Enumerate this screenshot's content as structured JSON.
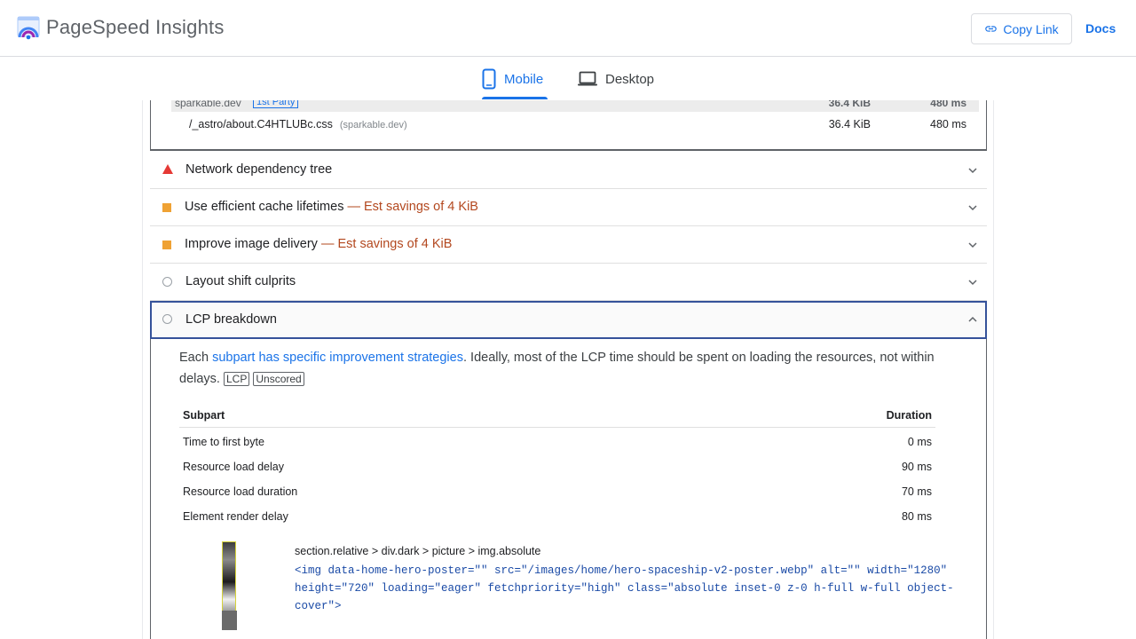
{
  "header": {
    "app_title": "PageSpeed Insights",
    "copy_link_label": "Copy Link",
    "docs_label": "Docs"
  },
  "tabs": [
    {
      "label": "Mobile",
      "selected": true
    },
    {
      "label": "Desktop",
      "selected": false
    }
  ],
  "resource_table": {
    "party_row": {
      "host": "sparkable.dev",
      "badge": "1st Party",
      "size": "36.4 KiB",
      "time": "480 ms"
    },
    "file_row": {
      "url": "/_astro/about.C4HTLUBc.css",
      "origin": "(sparkable.dev)",
      "size": "36.4 KiB",
      "time": "480 ms"
    }
  },
  "audits": [
    {
      "title": "Network dependency tree",
      "savings": "",
      "icon": "fail-triangle-icon"
    },
    {
      "title": "Use efficient cache lifetimes",
      "savings": "— Est savings of 4 KiB",
      "icon": "average-square-icon"
    },
    {
      "title": "Improve image delivery",
      "savings": "— Est savings of 4 KiB",
      "icon": "average-square-icon"
    },
    {
      "title": "Layout shift culprits",
      "savings": "",
      "icon": "info-circle-icon"
    }
  ],
  "lcp": {
    "title": "LCP breakdown",
    "desc_before": "Each ",
    "desc_link": "subpart has specific improvement strategies",
    "desc_after": ". Ideally, most of the LCP time should be spent on loading the resources, not within delays.",
    "tags": [
      "LCP",
      "Unscored"
    ],
    "table": {
      "headers": [
        "Subpart",
        "Duration"
      ],
      "rows": [
        {
          "subpart": "Time to first byte",
          "duration": "0 ms"
        },
        {
          "subpart": "Resource load delay",
          "duration": "90 ms"
        },
        {
          "subpart": "Resource load duration",
          "duration": "70 ms"
        },
        {
          "subpart": "Element render delay",
          "duration": "80 ms"
        }
      ]
    },
    "node": {
      "path": "section.relative > div.dark > picture > img.absolute",
      "snippet_line1": "<img data-home-hero-poster=\"\" src=\"/images/home/hero-spaceship-v2-poster.webp\" alt=\"\" width=\"1280\"",
      "snippet_line2": "height=\"720\" loading=\"eager\" fetchpriority=\"high\" class=\"absolute inset-0 z-0 h-full w-full object-cover\">"
    }
  },
  "colors": {
    "accent": "#1a73e8",
    "fail": "#e53935",
    "average": "#efa234",
    "savings": "#b3481f"
  }
}
